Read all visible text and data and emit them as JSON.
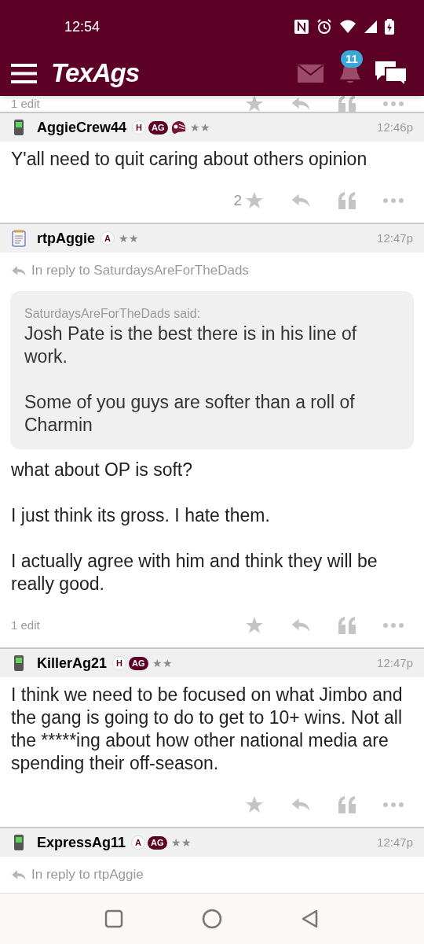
{
  "status_bar": {
    "time": "12:54"
  },
  "header": {
    "logo": "TexAgs",
    "notification_count": "11"
  },
  "top_fragment": {
    "edits": "1 edit"
  },
  "posts": [
    {
      "user": "AggieCrew44",
      "device": {
        "kind": "phone"
      },
      "badges": [
        {
          "kind": "outline",
          "text": "H"
        },
        {
          "kind": "filled",
          "text": "AG"
        },
        {
          "kind": "helmet"
        }
      ],
      "rank": "★★",
      "time": "12:46p",
      "paragraphs": [
        "Y'all need to quit caring about others opinion"
      ],
      "likes": "2"
    },
    {
      "user": "rtpAggie",
      "device": {
        "kind": "notepad"
      },
      "badges": [
        {
          "kind": "outline",
          "text": "A"
        }
      ],
      "rank": "★★",
      "time": "12:47p",
      "reply_to": "In reply to SaturdaysAreForTheDads",
      "quote": {
        "author": "SaturdaysAreForTheDads said:",
        "paragraphs": [
          "Josh Pate is the best there is in his line of work.",
          "Some of you guys are softer than a roll of Charmin"
        ]
      },
      "paragraphs": [
        "what about OP is soft?",
        "I just think its gross. I hate them.",
        "I actually agree with him and think they will be really good."
      ],
      "edits": "1 edit"
    },
    {
      "user": "KillerAg21",
      "device": {
        "kind": "phone"
      },
      "badges": [
        {
          "kind": "outline",
          "text": "H"
        },
        {
          "kind": "filled",
          "text": "AG"
        }
      ],
      "rank": "★★",
      "time": "12:47p",
      "paragraphs": [
        "I think we need to be focused on what Jimbo and the gang is going to do to get to 10+ wins. Not all the *****ing about how other national media are spending their off-season."
      ]
    },
    {
      "user": "ExpressAg11",
      "device": {
        "kind": "phone"
      },
      "badges": [
        {
          "kind": "outline",
          "text": "A"
        },
        {
          "kind": "filled",
          "text": "AG"
        }
      ],
      "rank": "★★",
      "time": "12:47p",
      "reply_to": "In reply to rtpAggie"
    }
  ]
}
